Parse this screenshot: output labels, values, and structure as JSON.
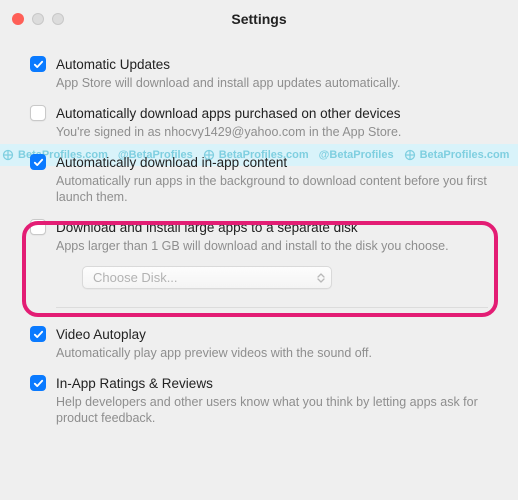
{
  "window": {
    "title": "Settings"
  },
  "watermark": {
    "text1": "BetaProfiles.com",
    "text2": "@BetaProfiles"
  },
  "options": [
    {
      "id": "auto-updates",
      "checked": true,
      "label": "Automatic Updates",
      "desc": "App Store will download and install app updates automatically."
    },
    {
      "id": "auto-download-purchased",
      "checked": false,
      "label": "Automatically download apps purchased on other devices",
      "desc": "You're signed in as nhocvy1429@yahoo.com in the App Store."
    },
    {
      "id": "auto-download-inapp",
      "checked": true,
      "label": "Automatically download in-app content",
      "desc": "Automatically run apps in the background to download content before you first launch them."
    },
    {
      "id": "large-apps-disk",
      "checked": false,
      "label": "Download and install large apps to a separate disk",
      "desc": "Apps larger than 1 GB will download and install to the disk you choose."
    },
    {
      "id": "video-autoplay",
      "checked": true,
      "label": "Video Autoplay",
      "desc": "Automatically play app preview videos with the sound off."
    },
    {
      "id": "ratings-reviews",
      "checked": true,
      "label": "In-App Ratings & Reviews",
      "desc": "Help developers and other users know what you think by letting apps ask for product feedback."
    }
  ],
  "disk_selector": {
    "placeholder": "Choose Disk..."
  }
}
